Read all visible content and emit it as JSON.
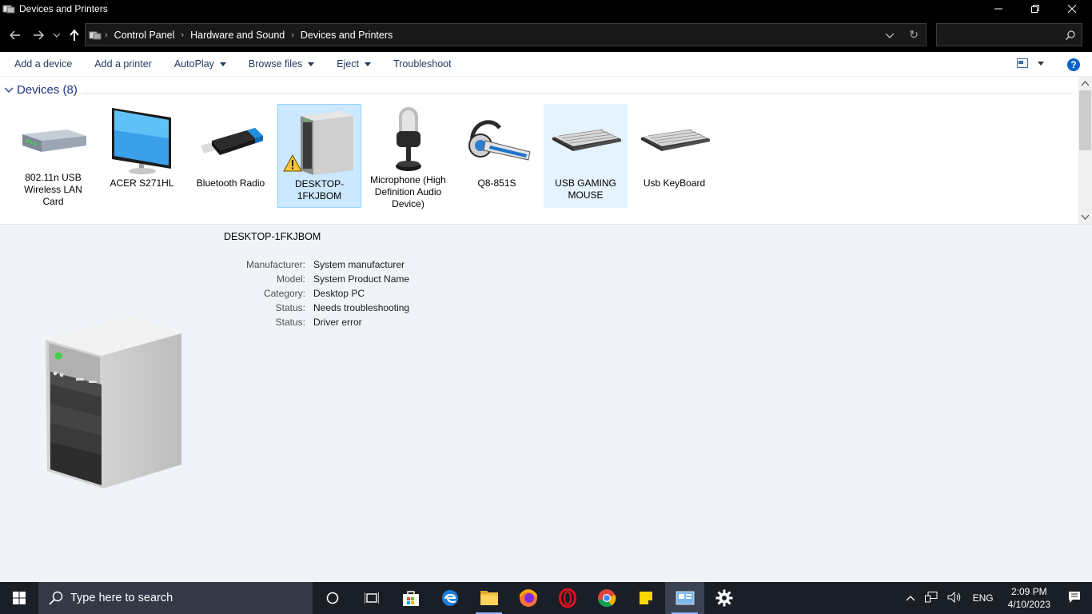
{
  "window": {
    "title": "Devices and Printers",
    "minimize_icon": "minimize-icon",
    "restore_icon": "restore-icon",
    "close_icon": "close-icon"
  },
  "address_bar": {
    "breadcrumbs": [
      "Control Panel",
      "Hardware and Sound",
      "Devices and Printers"
    ],
    "search_placeholder": ""
  },
  "toolbar": {
    "add_device": "Add a device",
    "add_printer": "Add a printer",
    "autoplay": "AutoPlay",
    "browse_files": "Browse files",
    "eject": "Eject",
    "troubleshoot": "Troubleshoot"
  },
  "devices": {
    "group_label": "Devices (8)",
    "items": [
      {
        "label": "802.11n USB Wireless LAN Card",
        "icon": "wlan-adapter-icon"
      },
      {
        "label": "ACER S271HL",
        "icon": "monitor-icon"
      },
      {
        "label": "Bluetooth Radio",
        "icon": "usb-dongle-icon"
      },
      {
        "label": "DESKTOP-1FKJBOM",
        "icon": "desktop-pc-icon",
        "state": "selected",
        "warning": true
      },
      {
        "label": "Microphone (High Definition Audio Device)",
        "icon": "microphone-icon"
      },
      {
        "label": "Q8-851S",
        "icon": "headset-icon"
      },
      {
        "label": "USB GAMING MOUSE",
        "icon": "keyboard-icon",
        "state": "hover"
      },
      {
        "label": "Usb KeyBoard",
        "icon": "keyboard-icon"
      }
    ]
  },
  "details": {
    "title": "DESKTOP-1FKJBOM",
    "properties": [
      {
        "key": "Manufacturer:",
        "value": "System manufacturer"
      },
      {
        "key": "Model:",
        "value": "System Product Name"
      },
      {
        "key": "Category:",
        "value": "Desktop PC"
      },
      {
        "key": "Status:",
        "value": "Needs troubleshooting"
      },
      {
        "key": "Status:",
        "value": "Driver error"
      }
    ]
  },
  "taskbar": {
    "search_placeholder": "Type here to search",
    "language": "ENG",
    "time": "2:09 PM",
    "date": "4/10/2023"
  },
  "colors": {
    "accent": "#0078d7",
    "selection": "#cce8ff",
    "link": "#1e395b",
    "taskbar": "#1a1f27"
  }
}
